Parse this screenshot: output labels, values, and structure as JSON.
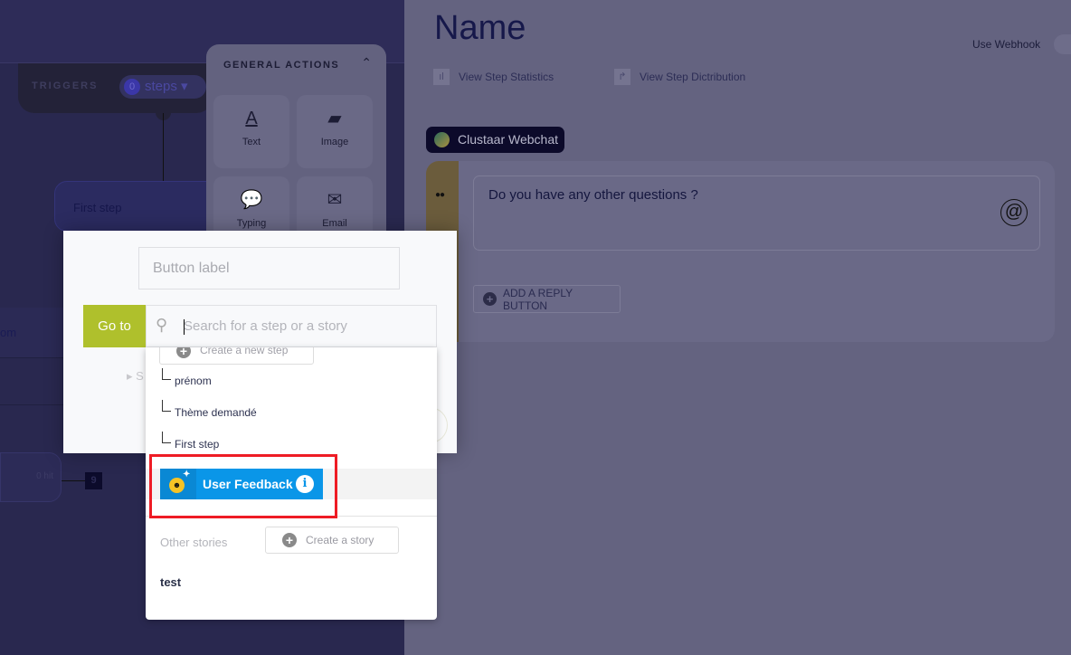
{
  "canvas": {
    "triggers_label": "TRIGGERS",
    "trigger_count": "0",
    "trigger_unit": "steps",
    "first_step": "First step",
    "node_partial": "om",
    "hit_label": "0 hit",
    "badge": "9"
  },
  "actions_panel": {
    "title": "GENERAL ACTIONS",
    "tiles": [
      {
        "label": "Text",
        "icon": "text-icon"
      },
      {
        "label": "Image",
        "icon": "image-icon"
      },
      {
        "label": "Typing",
        "icon": "typing-icon"
      },
      {
        "label": "Email",
        "icon": "email-icon"
      }
    ]
  },
  "step": {
    "title": "Name",
    "use_webhook": "Use Webhook",
    "view_statistics": "View Step Statistics",
    "view_distribution": "View Step Dictribution",
    "channel": "Clustaar Webchat",
    "message": "Do you have any other questions ?",
    "add_reply": "ADD A REPLY BUTTON"
  },
  "modal": {
    "button_label_placeholder": "Button label",
    "goto": "Go to",
    "search_placeholder": "Search for a step or a story",
    "collapsed_partial": "S",
    "accent": "#afc02c"
  },
  "dropdown": {
    "create_step": "Create a new step",
    "steps": [
      "prénom",
      "Thème demandé",
      "First step"
    ],
    "current_story": "User Feedback",
    "other_stories_label": "Other stories",
    "create_story": "Create a story",
    "other_stories": [
      "test"
    ],
    "highlight_color": "#0a96e8"
  }
}
